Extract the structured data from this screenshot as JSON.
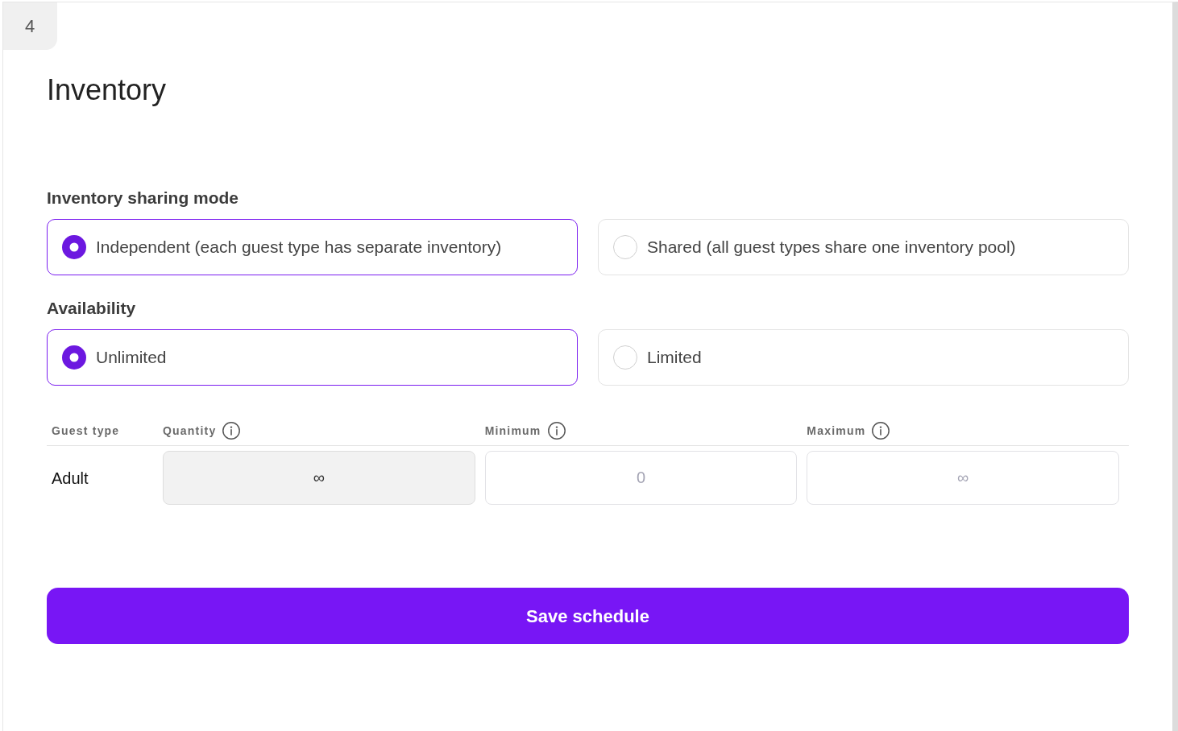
{
  "step": {
    "number": "4"
  },
  "title": "Inventory",
  "sections": [
    {
      "label": "Inventory sharing mode",
      "options": [
        {
          "label": "Independent (each guest type has separate inventory)",
          "selected": true
        },
        {
          "label": "Shared (all guest types share one inventory pool)",
          "selected": false
        }
      ]
    },
    {
      "label": "Availability",
      "options": [
        {
          "label": "Unlimited",
          "selected": true
        },
        {
          "label": "Limited",
          "selected": false
        }
      ]
    }
  ],
  "table": {
    "columns": [
      {
        "label": "Guest type",
        "info": false
      },
      {
        "label": "Quantity",
        "info": true
      },
      {
        "label": "Minimum",
        "info": true
      },
      {
        "label": "Maximum",
        "info": true
      }
    ],
    "rows": [
      {
        "guest_type": "Adult",
        "fields": [
          {
            "value": "∞",
            "disabled": true
          },
          {
            "placeholder": "0",
            "disabled": false
          },
          {
            "placeholder": "∞",
            "disabled": false
          }
        ]
      }
    ]
  },
  "save_button": {
    "label": "Save schedule"
  }
}
